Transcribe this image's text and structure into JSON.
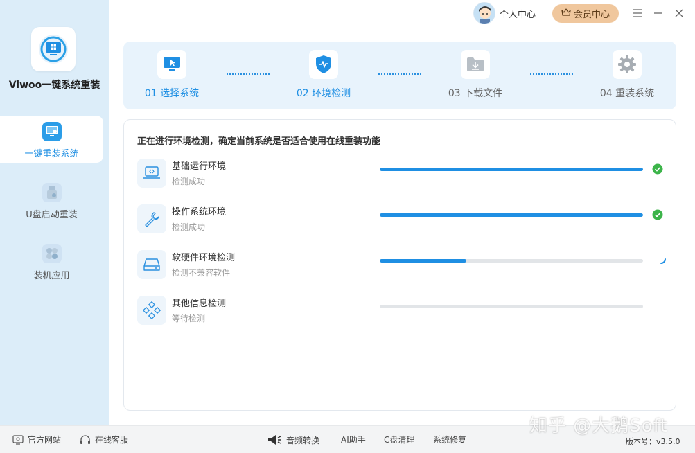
{
  "app": {
    "name": "Viwoo一键系统重装"
  },
  "sidebar": {
    "items": [
      {
        "label": "一键重装系统",
        "icon": "monitor-icon",
        "active": true
      },
      {
        "label": "U盘启动重装",
        "icon": "usb-icon",
        "active": false
      },
      {
        "label": "装机应用",
        "icon": "apps-icon",
        "active": false
      }
    ]
  },
  "header": {
    "user_label": "个人中心",
    "vip_label": "会员中心"
  },
  "steps": [
    {
      "label": "01 选择系统",
      "icon": "cursor-monitor-icon",
      "state": "done"
    },
    {
      "label": "02 环境检测",
      "icon": "shield-icon",
      "state": "done"
    },
    {
      "label": "03 下载文件",
      "icon": "download-folder-icon",
      "state": "pending"
    },
    {
      "label": "04 重装系统",
      "icon": "gear-icon",
      "state": "pending"
    }
  ],
  "main": {
    "title": "正在进行环境检测，确定当前系统是否适合使用在线重装功能",
    "checks": [
      {
        "name": "基础运行环境",
        "status": "检测成功",
        "progress": 1.0,
        "state": "success",
        "icon": "laptop-code-icon"
      },
      {
        "name": "操作系统环境",
        "status": "检测成功",
        "progress": 1.0,
        "state": "success",
        "icon": "wrench-icon"
      },
      {
        "name": "软硬件环境检测",
        "status": "检测不兼容软件",
        "progress": 0.33,
        "state": "running",
        "icon": "hard-drive-icon"
      },
      {
        "name": "其他信息检测",
        "status": "等待检测",
        "progress": 0.0,
        "state": "waiting",
        "icon": "diamond-grid-icon"
      }
    ]
  },
  "footer": {
    "website": "官方网站",
    "support": "在线客服",
    "tools": [
      "音频转换",
      "AI助手",
      "C盘清理",
      "系统修复"
    ],
    "version": "版本号：v3.5.0"
  },
  "watermark": "知乎 @大鹅Soft",
  "colors": {
    "accent": "#1f8fe3",
    "success": "#3cb44a",
    "sidebar_bg": "#dcedf9",
    "vip_bg": "#f0c79d"
  }
}
